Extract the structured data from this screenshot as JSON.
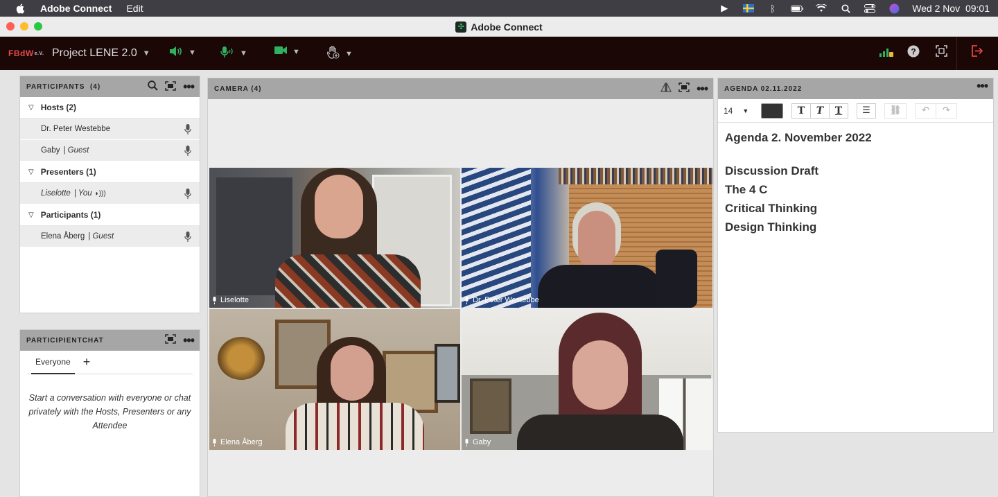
{
  "menubar": {
    "app_name": "Adobe Connect",
    "edit": "Edit",
    "datetime": "Wed 2 Nov  09:01"
  },
  "window": {
    "title": "Adobe Connect"
  },
  "toolbar": {
    "logo": "FBdW",
    "logo_suffix": "e.V.",
    "project": "Project LENE 2.0"
  },
  "participants": {
    "header": "PARTICIPANTS  (4)",
    "groups": [
      {
        "label": "Hosts (2)",
        "people": [
          {
            "name": "Dr. Peter Westebbe",
            "role": ""
          },
          {
            "name": "Gaby",
            "role": "| Guest"
          }
        ]
      },
      {
        "label": "Presenters (1)",
        "people": [
          {
            "name": "Liselotte",
            "role": "| You"
          }
        ]
      },
      {
        "label": "Participants (1)",
        "people": [
          {
            "name": "Elena Åberg",
            "role": "| Guest"
          }
        ]
      }
    ]
  },
  "chat": {
    "header": "PARTICIPIENTCHAT",
    "tab": "Everyone",
    "message": "Start a conversation with everyone or chat privately with the Hosts, Presenters or any Attendee"
  },
  "camera": {
    "header": "CAMERA (4)",
    "feeds": [
      {
        "name": "Liselotte"
      },
      {
        "name": "Dr. Peter Westebbe"
      },
      {
        "name": "Elena Åberg"
      },
      {
        "name": "Gaby"
      }
    ]
  },
  "agenda": {
    "header": "AGENDA 02.11.2022",
    "font_size": "14",
    "title": "Agenda 2. November 2022",
    "items": [
      "Discussion Draft",
      "The 4 C",
      "Critical Thinking",
      "Design Thinking"
    ]
  },
  "colors": {
    "toolbar_bg": "#1c0707",
    "accent_green": "#2fb15f",
    "pod_header": "#a6a6a6",
    "exit_red": "#e8453c"
  }
}
